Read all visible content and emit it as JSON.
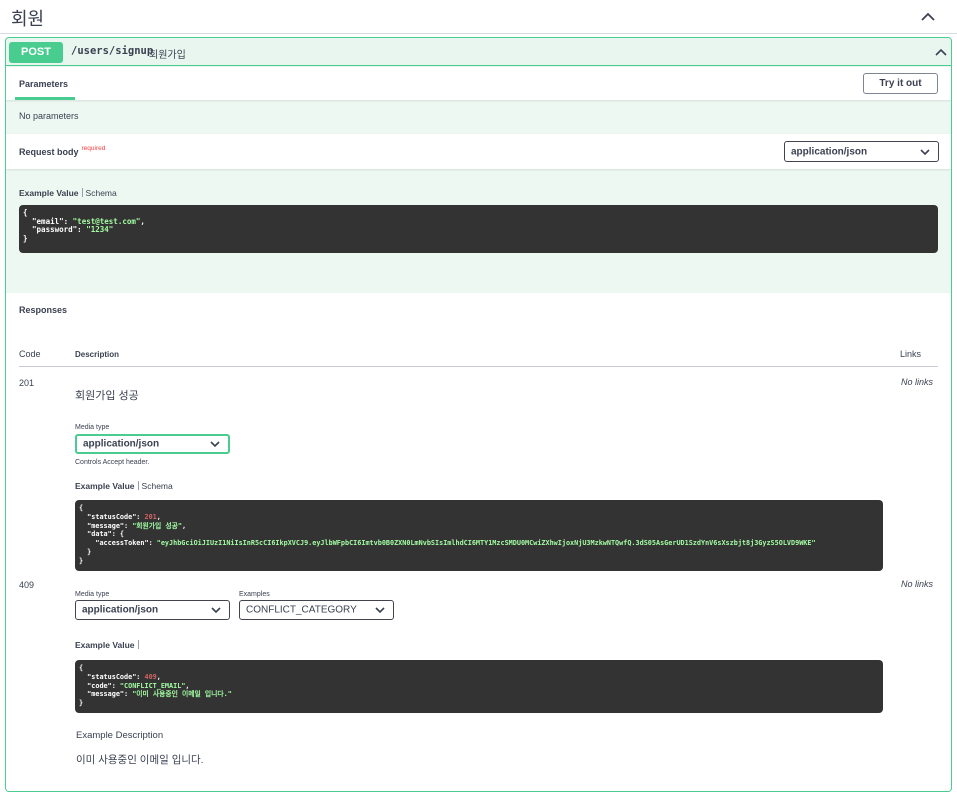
{
  "tag": {
    "title": "회원"
  },
  "operation": {
    "method": "POST",
    "path": "/users/signup",
    "summary": "회원가입"
  },
  "parameters": {
    "tab_label": "Parameters",
    "try_button": "Try it out",
    "empty_text": "No parameters"
  },
  "request_body": {
    "title": "Request body",
    "required_label": "required",
    "content_type": "application/json",
    "tab_example": "Example Value",
    "tab_schema": "Schema",
    "example": {
      "open": "{",
      "line1_key": "  \"email\": ",
      "line1_val": "\"test@test.com\"",
      "line1_end": ",",
      "line2_key": "  \"password\": ",
      "line2_val": "\"1234\"",
      "close": "}"
    }
  },
  "responses": {
    "title": "Responses",
    "col_code": "Code",
    "col_description": "Description",
    "col_links": "Links",
    "r201": {
      "code": "201",
      "description": "회원가입 성공",
      "links": "No links",
      "media_type_label": "Media type",
      "media_type": "application/json",
      "accept_note": "Controls Accept header.",
      "tab_example": "Example Value",
      "tab_schema": "Schema",
      "example": {
        "open": "{",
        "k1": "  \"statusCode\": ",
        "v1": "201",
        "k2": "  \"message\": ",
        "v2": "\"회원가입 성공\"",
        "k3": "  \"data\": {",
        "k4": "    \"accessToken\": ",
        "v4": "\"eyJhbGciOiJIUzI1NiIsInR5cCI6IkpXVCJ9.eyJlbWFpbCI6Imtvb0B0ZXN0LmNvbSIsImlhdCI6MTY1MzcSMDU0MCwiZXhwIjoxNjU3MzkwNTQwfQ.3dS05AsGerUD1SzdYnV6sXszbjt8j3GyzS5OLVD9WKE\"",
        "k5": "  }",
        "close": "}"
      }
    },
    "r409": {
      "code": "409",
      "links": "No links",
      "media_type_label": "Media type",
      "media_type": "application/json",
      "examples_label": "Examples",
      "examples_value": "CONFLICT_CATEGORY",
      "tab_example": "Example Value",
      "example": {
        "open": "{",
        "k1": "  \"statusCode\": ",
        "v1": "409",
        "k2": "  \"code\": ",
        "v2": "\"CONFLICT_EMAIL\"",
        "k3": "  \"message\": ",
        "v3": "\"이미 사용중인 이메일 입니다.\"",
        "close": "}"
      },
      "example_description_title": "Example Description",
      "example_description": "이미 사용중인 이메일 입니다."
    }
  },
  "colors": {
    "post_green": "#49cc90",
    "code_bg": "#333333",
    "string_green": "#a2fca2",
    "number_red": "#d36363"
  },
  "icons": {
    "tag_toggle": "chevron-up-icon",
    "op_toggle": "chevron-up-icon",
    "select_arrow": "chevron-down-icon"
  }
}
